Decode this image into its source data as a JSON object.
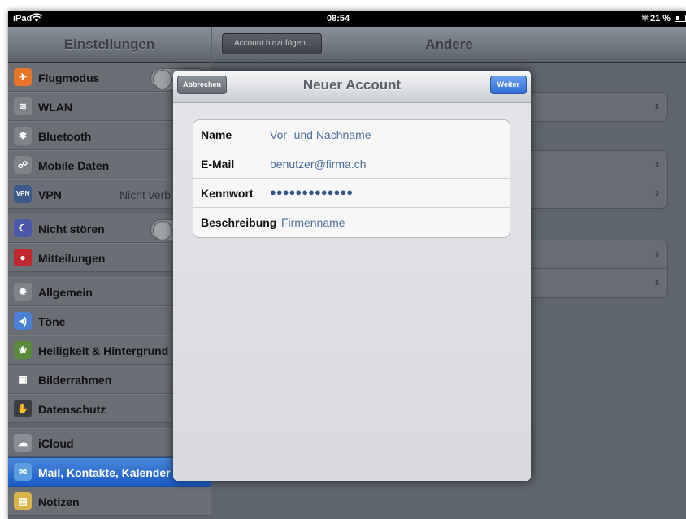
{
  "status_bar": {
    "device": "iPad",
    "time": "08:54",
    "battery": "21 %"
  },
  "sidebar": {
    "title": "Einstellungen",
    "items": [
      {
        "label": "Flugmodus",
        "icon": "airplane-icon",
        "icon_color": "#e8742a",
        "has_toggle": true
      },
      {
        "label": "WLAN",
        "icon": "wifi-icon",
        "icon_color": "#7f8388"
      },
      {
        "label": "Bluetooth",
        "icon": "bluetooth-icon",
        "icon_color": "#7f8388"
      },
      {
        "label": "Mobile Daten",
        "icon": "antenna-icon",
        "icon_color": "#7f8388"
      },
      {
        "label": "VPN",
        "icon": "vpn-icon",
        "icon_color": "#3b5a8a",
        "value": "Nicht verb"
      },
      {
        "label": "Nicht stören",
        "icon": "moon-icon",
        "icon_color": "#4b57a8",
        "has_toggle": true
      },
      {
        "label": "Mitteilungen",
        "icon": "notifications-icon",
        "icon_color": "#c0282d"
      },
      {
        "label": "Allgemein",
        "icon": "gear-icon",
        "icon_color": "#7f8388"
      },
      {
        "label": "Töne",
        "icon": "speaker-icon",
        "icon_color": "#4a7fd4"
      },
      {
        "label": "Helligkeit & Hintergrund",
        "icon": "flower-icon",
        "icon_color": "#5a8a3a"
      },
      {
        "label": "Bilderrahmen",
        "icon": "picture-frame-icon",
        "icon_color": "#6b6f75"
      },
      {
        "label": "Datenschutz",
        "icon": "hand-icon",
        "icon_color": "#3a3d42"
      },
      {
        "label": "iCloud",
        "icon": "cloud-icon",
        "icon_color": "#8a8e94"
      },
      {
        "label": "Mail, Kontakte, Kalender",
        "icon": "mail-icon",
        "icon_color": "#5a9ee0",
        "selected": true
      },
      {
        "label": "Notizen",
        "icon": "notes-icon",
        "icon_color": "#d8b34a"
      }
    ]
  },
  "detail": {
    "title": "Andere",
    "back_label": "Account hinzufügen ..."
  },
  "modal": {
    "title": "Neuer Account",
    "cancel_label": "Abbrechen",
    "next_label": "Weiter",
    "fields": [
      {
        "label": "Name",
        "value": "Vor- und Nachname"
      },
      {
        "label": "E-Mail",
        "value": "benutzer@firma.ch"
      },
      {
        "label": "Kennwort",
        "value": "●●●●●●●●●●●●●"
      },
      {
        "label": "Beschreibung",
        "value": "Firmenname"
      }
    ]
  }
}
